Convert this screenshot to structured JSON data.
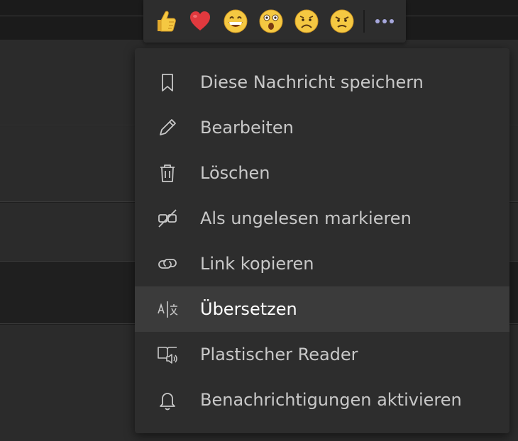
{
  "reactions": [
    {
      "icon": "thumbs-up-icon"
    },
    {
      "icon": "heart-icon"
    },
    {
      "icon": "laughing-emoji-icon"
    },
    {
      "icon": "surprised-emoji-icon"
    },
    {
      "icon": "sad-emoji-icon"
    },
    {
      "icon": "angry-emoji-icon"
    }
  ],
  "more_options_icon": "more-options-icon",
  "colors": {
    "emoji_yellow": "#f5c842",
    "heart_red": "#e0393e",
    "more_dots": "#a6a7dc",
    "menu_bg": "#2d2d2d",
    "menu_hover": "#3b3b3b",
    "text": "#c8c8c8"
  },
  "menu": {
    "items": [
      {
        "label": "Diese Nachricht speichern",
        "icon": "bookmark-icon"
      },
      {
        "label": "Bearbeiten",
        "icon": "pencil-icon"
      },
      {
        "label": "Löschen",
        "icon": "trash-icon"
      },
      {
        "label": "Als ungelesen markieren",
        "icon": "mark-unread-icon"
      },
      {
        "label": "Link kopieren",
        "icon": "link-icon"
      },
      {
        "label": "Übersetzen",
        "icon": "translate-icon",
        "highlighted": true
      },
      {
        "label": "Plastischer Reader",
        "icon": "immersive-reader-icon"
      },
      {
        "label": "Benachrichtigungen aktivieren",
        "icon": "bell-icon"
      }
    ]
  }
}
